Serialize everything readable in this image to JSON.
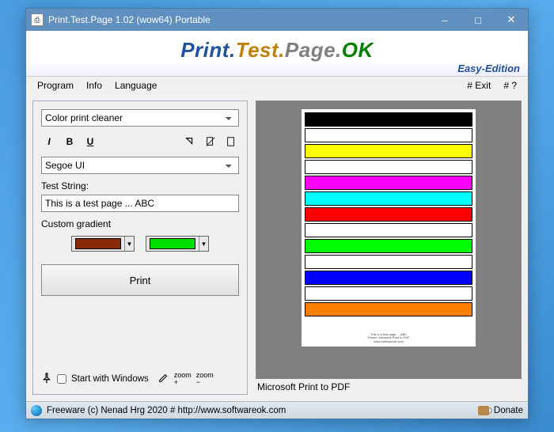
{
  "window": {
    "title": "Print.Test.Page 1.02  (wow64)  Portable"
  },
  "banner": {
    "brand_parts": [
      "Print.",
      "Test.",
      "Page.",
      "OK"
    ],
    "edition": "Easy-Edition"
  },
  "menu": {
    "program": "Program",
    "info": "Info",
    "language": "Language",
    "exit": "# Exit",
    "help": "# ?"
  },
  "controls": {
    "mode_selected": "Color print cleaner",
    "font_selected": "Segoe UI",
    "test_string_label": "Test String:",
    "test_string_value": "This is a test page ... ABC",
    "custom_gradient_label": "Custom gradient",
    "gradient_color_1": "#8b2a0a",
    "gradient_color_2": "#00e000",
    "print_label": "Print",
    "start_with_windows": "Start with Windows"
  },
  "preview": {
    "printer_label": "Microsoft Print to PDF",
    "bars": [
      "#000000",
      "#ffffff",
      "#ffff00",
      "#ffffff",
      "#ff00ff",
      "#00ffff",
      "#ff0000",
      "#ffffff",
      "#00ff00",
      "#ffffff",
      "#0000ff",
      "#ffffff",
      "#ff8000"
    ],
    "footer_lines": [
      "This is a test page ... ABC",
      "Printer: Microsoft Print to PDF",
      "www.softwareok.com"
    ]
  },
  "status": {
    "freeware": "Freeware (c) Nenad Hrg 2020 # http://www.softwareok.com",
    "donate": "Donate"
  }
}
